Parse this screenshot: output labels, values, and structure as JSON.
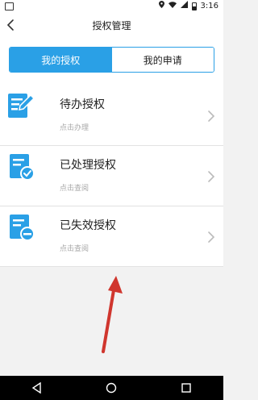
{
  "status_bar": {
    "time": "3:16"
  },
  "header": {
    "title": "授权管理",
    "back_icon": "chevron-left-icon"
  },
  "tabs": [
    {
      "label": "我的授权",
      "active": true
    },
    {
      "label": "我的申请",
      "active": false
    }
  ],
  "list": [
    {
      "title": "待办授权",
      "subtitle": "点击办理",
      "icon": "edit-document-icon"
    },
    {
      "title": "已处理授权",
      "subtitle": "点击查阅",
      "icon": "approved-document-icon"
    },
    {
      "title": "已失效授权",
      "subtitle": "点击查阅",
      "icon": "expired-document-icon"
    }
  ],
  "colors": {
    "accent": "#2aa0e6",
    "annotation_arrow": "#d0362e"
  }
}
